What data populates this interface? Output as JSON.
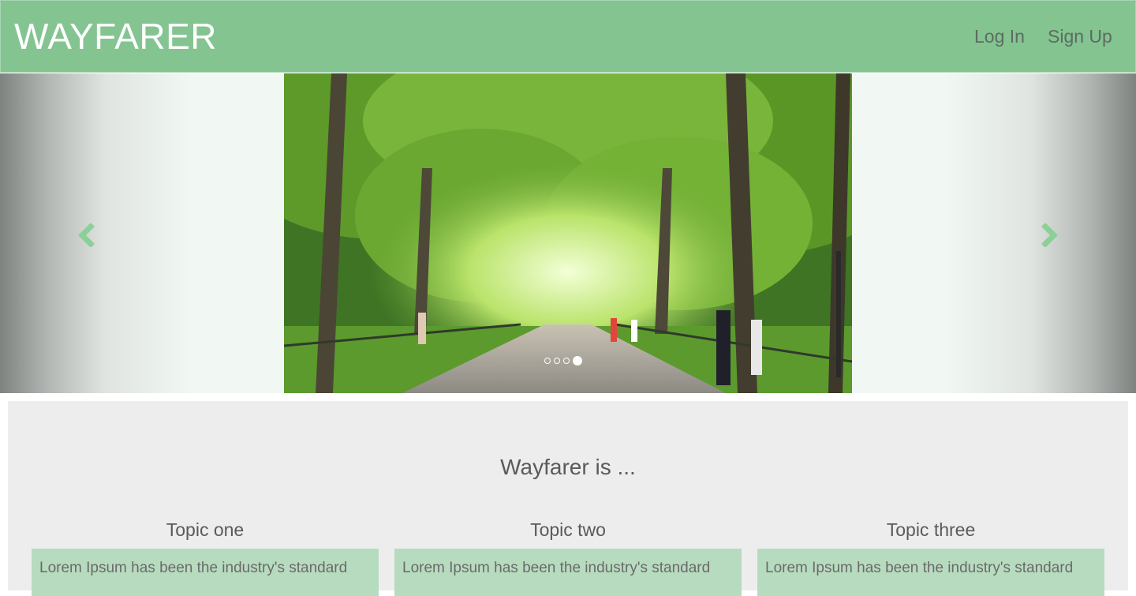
{
  "navbar": {
    "brand": "WAYFARER",
    "links": [
      "Log In",
      "Sign Up"
    ]
  },
  "carousel": {
    "image_alt": "Tree-lined park promenade with walkers",
    "slide_count": 4,
    "active_index": 3,
    "prev_icon": "chevron-left-icon",
    "next_icon": "chevron-right-icon"
  },
  "about": {
    "title": "Wayfarer is ...",
    "topics": [
      {
        "title": "Topic one",
        "body": "Lorem Ipsum has been the industry's standard"
      },
      {
        "title": "Topic two",
        "body": "Lorem Ipsum has been the industry's standard"
      },
      {
        "title": "Topic three",
        "body": "Lorem Ipsum has been the industry's standard"
      }
    ]
  },
  "colors": {
    "brand_green": "#84c491",
    "topic_green": "#b7dbbe",
    "section_gray": "#ededed"
  }
}
